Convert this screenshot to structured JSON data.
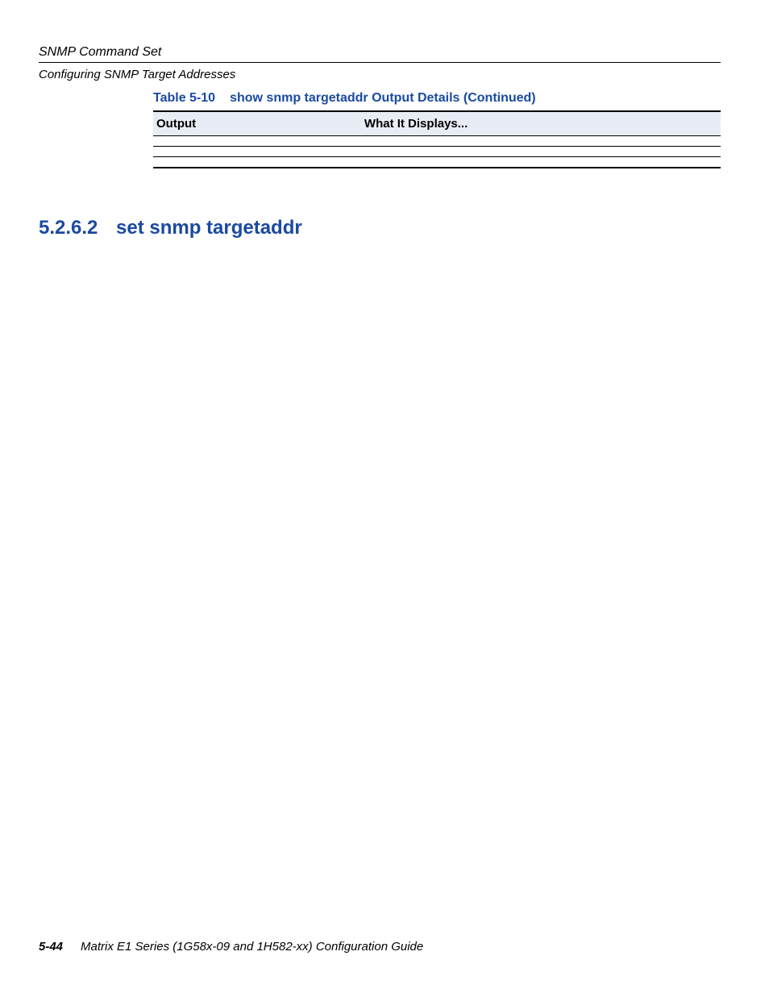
{
  "header": {
    "line1": "SNMP Command Set",
    "line2": "Configuring SNMP Target Addresses"
  },
  "table": {
    "caption_number": "Table 5-10",
    "caption_title": "show snmp targetaddr Output Details (Continued)",
    "col_output": "Output",
    "col_desc": "What It Displays...",
    "rows": [
      {
        "output": " ",
        "desc": " "
      },
      {
        "output": " ",
        "desc": " "
      },
      {
        "output": " ",
        "desc": " "
      }
    ]
  },
  "section": {
    "number": "5.2.6.2",
    "title": "set snmp targetaddr"
  },
  "footer": {
    "page": "5-44",
    "book": "Matrix E1 Series (1G58x-09 and 1H582-xx) Configuration Guide"
  }
}
